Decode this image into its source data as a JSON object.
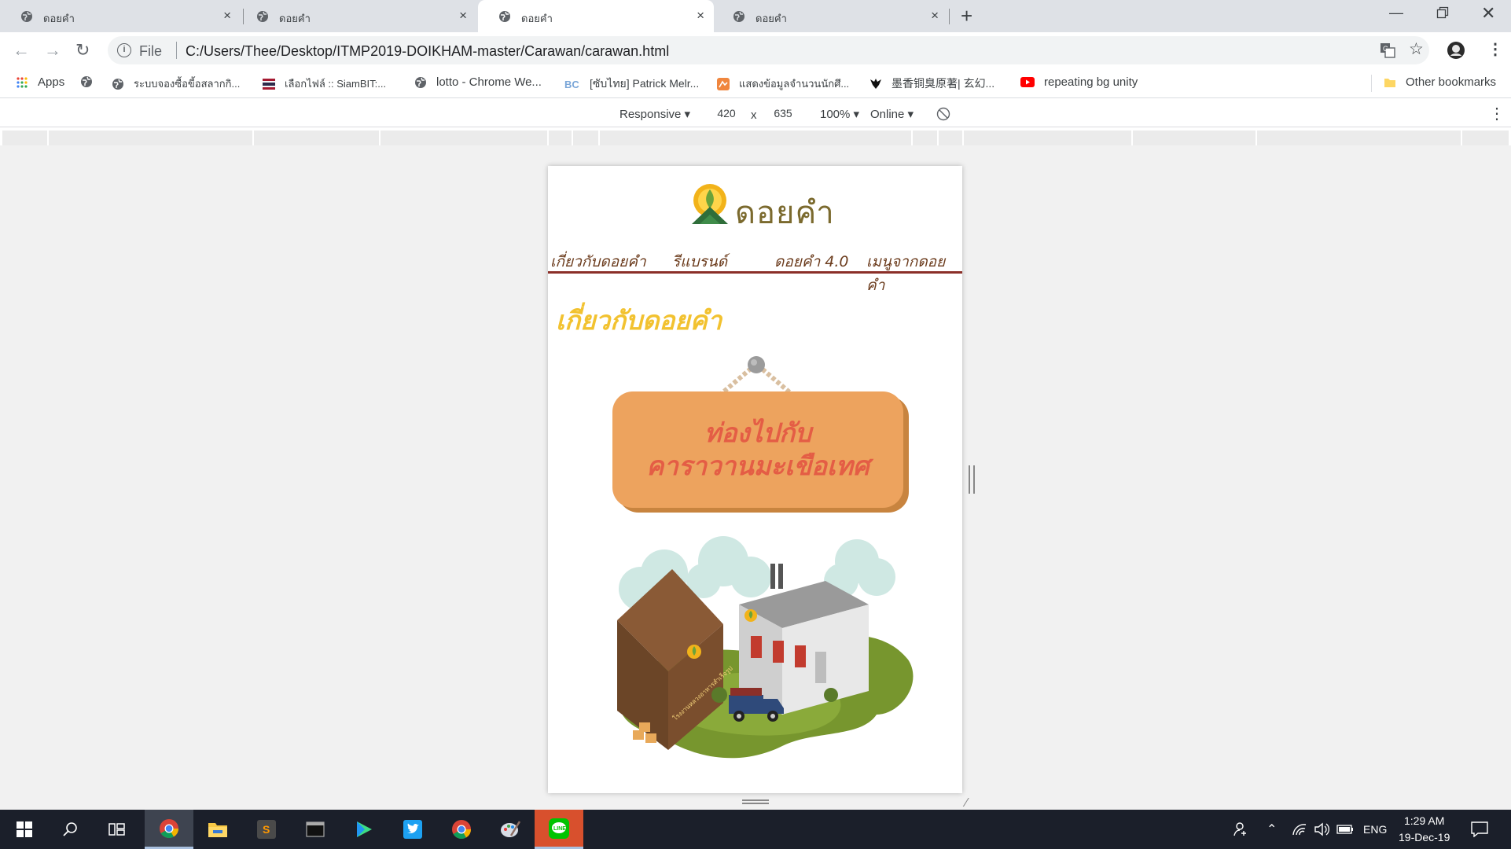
{
  "browser": {
    "tabs": [
      {
        "title": "ดอยคำ",
        "active": false
      },
      {
        "title": "ดอยคำ",
        "active": false
      },
      {
        "title": "ดอยคำ",
        "active": true
      },
      {
        "title": "ดอยคำ",
        "active": false
      }
    ],
    "new_tab_symbol": "+",
    "close_symbol": "×",
    "omnibox": {
      "scheme_label": "File",
      "url": "C:/Users/Thee/Desktop/ITMP2019-DOIKHAM-master/Carawan/carawan.html"
    }
  },
  "bookmarks": [
    {
      "label": "Apps",
      "icon": "apps-grid-icon"
    },
    {
      "label": "",
      "icon": "globe-icon"
    },
    {
      "label": "ระบบจองซื้อขี้อสลากกิ...",
      "icon": "globe-icon"
    },
    {
      "label": "เลือกไฟล์ :: SiamBIT:...",
      "icon": "thai-flag-icon"
    },
    {
      "label": "lotto - Chrome We...",
      "icon": "globe-icon"
    },
    {
      "label": "[ซับไทย] Patrick Melr...",
      "icon": "bc-logo-icon"
    },
    {
      "label": "แสดงข้อมูลจำนวนนักศึ...",
      "icon": "orange-app-icon"
    },
    {
      "label": "墨香铜臭原著| 玄幻...",
      "icon": "black-bird-icon"
    },
    {
      "label": "repeating bg unity",
      "icon": "youtube-icon"
    },
    {
      "label": "Other bookmarks",
      "icon": "folder-icon"
    }
  ],
  "devtools": {
    "device": "Responsive",
    "width": "420",
    "times": "x",
    "height": "635",
    "zoom": "100%",
    "network": "Online"
  },
  "site": {
    "logo_text": "ดอยคำ",
    "nav": [
      "เกี่ยวกับดอยคำ",
      "รีแบรนด์",
      "ดอยคำ 4.0",
      "เมนูจากดอยคำ"
    ],
    "heading": "เกี่ยวกับดอยคำ",
    "sign_lines": [
      "ท่องไปกับ",
      "คาราวานมะเขือเทศ"
    ],
    "factory_sign_text": "โรงงานหลวงอาหารสำเร็จรูป"
  },
  "taskbar": {
    "apps": [
      "windows-start-icon",
      "search-icon",
      "task-view-icon",
      "chrome-icon",
      "file-explorer-icon",
      "sublime-text-icon",
      "terminal-icon",
      "media-player-icon",
      "twitter-icon",
      "chrome-icon",
      "paint-icon",
      "line-icon"
    ],
    "language": "ENG",
    "time": "1:29 AM",
    "date": "19-Dec-19"
  },
  "colors": {
    "brand_brown": "#8b2f28",
    "heading_yellow": "#f2c230",
    "sign_orange": "#eda35e",
    "sign_text": "#e45d45"
  }
}
